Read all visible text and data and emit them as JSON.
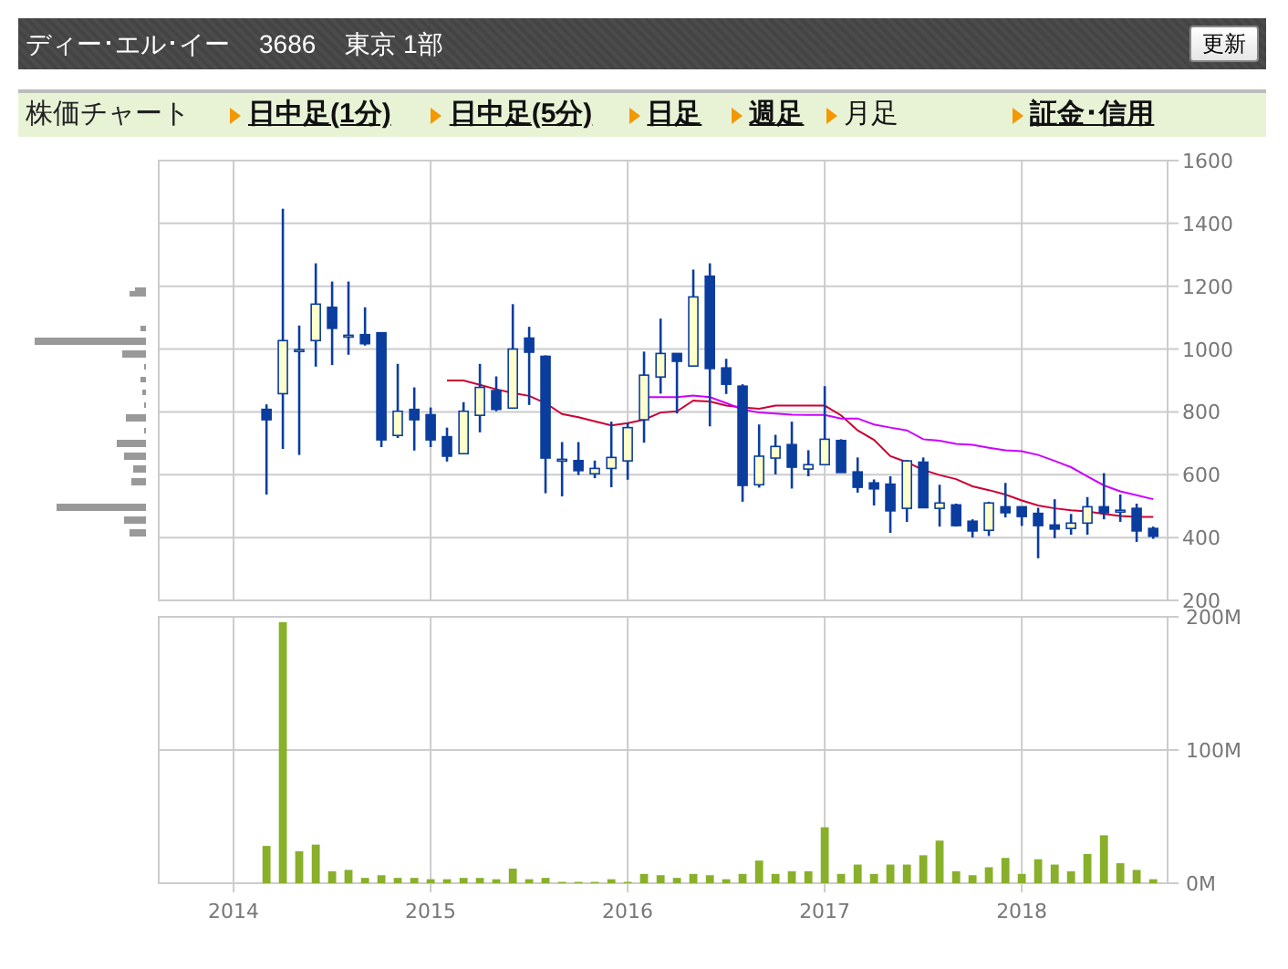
{
  "header": {
    "company": "ディー･エル･イー",
    "code": "3686",
    "market": "東京 1部",
    "refresh_button": "更新"
  },
  "chart_nav": {
    "label": "株価チャート",
    "tabs": [
      {
        "label": "日中足(1分)",
        "selected": false
      },
      {
        "label": "日中足(5分)",
        "selected": false
      },
      {
        "label": "日足",
        "selected": false
      },
      {
        "label": "週足",
        "selected": false
      },
      {
        "label": "月足",
        "selected": true
      },
      {
        "label": "証金･信用",
        "selected": false
      }
    ]
  },
  "price_chart": {
    "moving_averages": {
      "chart_data": {
        "type": "line",
        "grid": true,
        "xlim": [
          2013.62,
          2018.74
        ],
        "ylim": [
          200,
          1600
        ],
        "yticks": [
          200,
          400,
          600,
          800,
          1000,
          1200,
          1400,
          1600
        ],
        "x": [
          2015.083,
          2015.167,
          2015.25,
          2015.333,
          2015.417,
          2015.5,
          2015.583,
          2015.667,
          2015.75,
          2015.833,
          2015.917,
          2016,
          2016.083,
          2016.167,
          2016.25,
          2016.333,
          2016.417,
          2016.5,
          2016.583,
          2016.667,
          2016.75,
          2016.833,
          2016.917,
          2017,
          2017.083,
          2017.167,
          2017.25,
          2017.333,
          2017.417,
          2017.5,
          2017.583,
          2017.667,
          2017.75,
          2017.833,
          2017.917,
          2018,
          2018.083,
          2018.167,
          2018.25,
          2018.333,
          2018.417,
          2018.5,
          2018.583,
          2018.667
        ],
        "series": [
          {
            "color": "#cc0033",
            "values": [
              900,
              900,
              886,
              872,
              860,
              851,
              828,
              793,
              783,
              770,
              757,
              764,
              775,
              798,
              802,
              836,
              833,
              820,
              814,
              810,
              820,
              820,
              820,
              820,
              789,
              741,
              711,
              659,
              640,
              615,
              599,
              586,
              563,
              551,
              537,
              518,
              502,
              493,
              487,
              483,
              475,
              469,
              466,
              466
            ]
          },
          {
            "color": "#cc00ff",
            "values": [
              null,
              null,
              null,
              null,
              null,
              null,
              null,
              null,
              null,
              null,
              null,
              null,
              847,
              847,
              847,
              852,
              847,
              828,
              808,
              798,
              795,
              791,
              790,
              790,
              779,
              779,
              760,
              750,
              741,
              713,
              708,
              698,
              695,
              686,
              678,
              675,
              663,
              644,
              624,
              595,
              566,
              547,
              535,
              522
            ]
          }
        ]
      }
    },
    "candles": {
      "chart_data": {
        "type": "candlestick",
        "xlim": [
          2013.62,
          2018.74
        ],
        "ylim": [
          200,
          1600
        ],
        "x": [
          2014.167,
          2014.25,
          2014.333,
          2014.417,
          2014.5,
          2014.583,
          2014.667,
          2014.75,
          2014.833,
          2014.917,
          2015,
          2015.083,
          2015.167,
          2015.25,
          2015.333,
          2015.417,
          2015.5,
          2015.583,
          2015.667,
          2015.75,
          2015.833,
          2015.917,
          2016,
          2016.083,
          2016.167,
          2016.25,
          2016.333,
          2016.417,
          2016.5,
          2016.583,
          2016.667,
          2016.75,
          2016.833,
          2016.917,
          2017,
          2017.083,
          2017.167,
          2017.25,
          2017.333,
          2017.417,
          2017.5,
          2017.583,
          2017.667,
          2017.75,
          2017.833,
          2017.917,
          2018,
          2018.083,
          2018.167,
          2018.25,
          2018.333,
          2018.417,
          2018.5,
          2018.583,
          2018.667
        ],
        "ohlc": [
          [
            808,
            824,
            537,
            775
          ],
          [
            858,
            1447,
            682,
            1027
          ],
          [
            998,
            1075,
            663,
            998
          ],
          [
            1027,
            1273,
            944,
            1143
          ],
          [
            1133,
            1215,
            949,
            1066
          ],
          [
            1044,
            1215,
            982,
            1044
          ],
          [
            1046,
            1133,
            1011,
            1017
          ],
          [
            1052,
            1052,
            688,
            711
          ],
          [
            725,
            953,
            717,
            802
          ],
          [
            808,
            878,
            677,
            775
          ],
          [
            791,
            814,
            688,
            711
          ],
          [
            721,
            750,
            642,
            659
          ],
          [
            667,
            831,
            667,
            802
          ],
          [
            789,
            953,
            735,
            878
          ],
          [
            868,
            913,
            802,
            808
          ],
          [
            812,
            1143,
            812,
            1000
          ],
          [
            1035,
            1071,
            822,
            990
          ],
          [
            977,
            980,
            541,
            653
          ],
          [
            649,
            704,
            531,
            649
          ],
          [
            645,
            704,
            599,
            613
          ],
          [
            603,
            645,
            589,
            620
          ],
          [
            620,
            769,
            560,
            655
          ],
          [
            644,
            766,
            584,
            750
          ],
          [
            775,
            992,
            702,
            917
          ],
          [
            911,
            1097,
            858,
            986
          ],
          [
            986,
            986,
            795,
            961
          ],
          [
            946,
            1253,
            946,
            1166
          ],
          [
            1232,
            1273,
            754,
            938
          ],
          [
            940,
            969,
            857,
            888
          ],
          [
            882,
            888,
            514,
            566
          ],
          [
            568,
            760,
            559,
            659
          ],
          [
            653,
            727,
            601,
            690
          ],
          [
            696,
            769,
            556,
            624
          ],
          [
            618,
            678,
            595,
            632
          ],
          [
            632,
            882,
            632,
            713
          ],
          [
            709,
            713,
            607,
            607
          ],
          [
            609,
            655,
            543,
            560
          ],
          [
            574,
            585,
            502,
            555
          ],
          [
            570,
            595,
            415,
            485
          ],
          [
            493,
            647,
            450,
            644
          ],
          [
            640,
            655,
            495,
            495
          ],
          [
            493,
            568,
            435,
            510
          ],
          [
            504,
            508,
            435,
            438
          ],
          [
            452,
            458,
            400,
            421
          ],
          [
            423,
            514,
            405,
            510
          ],
          [
            498,
            574,
            464,
            479
          ],
          [
            498,
            498,
            437,
            467
          ],
          [
            477,
            495,
            334,
            438
          ],
          [
            440,
            522,
            398,
            427
          ],
          [
            429,
            475,
            409,
            446
          ],
          [
            446,
            529,
            409,
            498
          ],
          [
            498,
            605,
            458,
            479
          ],
          [
            487,
            537,
            450,
            487
          ],
          [
            493,
            508,
            386,
            421
          ],
          [
            429,
            435,
            396,
            404
          ]
        ]
      }
    }
  },
  "volume_chart": {
    "chart_data": {
      "type": "bar",
      "grid": true,
      "xlim": [
        2013.62,
        2018.74
      ],
      "ylim": [
        0,
        200
      ],
      "yticks": [
        {
          "value": 0,
          "label": "0M"
        },
        {
          "value": 100,
          "label": "100M"
        },
        {
          "value": 200,
          "label": "200M"
        }
      ],
      "xticks": [
        2014,
        2015,
        2016,
        2017,
        2018
      ],
      "x": [
        2014.167,
        2014.25,
        2014.333,
        2014.417,
        2014.5,
        2014.583,
        2014.667,
        2014.75,
        2014.833,
        2014.917,
        2015,
        2015.083,
        2015.167,
        2015.25,
        2015.333,
        2015.417,
        2015.5,
        2015.583,
        2015.667,
        2015.75,
        2015.833,
        2015.917,
        2016,
        2016.083,
        2016.167,
        2016.25,
        2016.333,
        2016.417,
        2016.5,
        2016.583,
        2016.667,
        2016.75,
        2016.833,
        2016.917,
        2017,
        2017.083,
        2017.167,
        2017.25,
        2017.333,
        2017.417,
        2017.5,
        2017.583,
        2017.667,
        2017.75,
        2017.833,
        2017.917,
        2018,
        2018.083,
        2018.167,
        2018.25,
        2018.333,
        2018.417,
        2018.5,
        2018.583,
        2018.667
      ],
      "series": [
        {
          "color": "#88b02a",
          "values": [
            28,
            196,
            24,
            29,
            9,
            10,
            4,
            6,
            4,
            4,
            3,
            3,
            4,
            4,
            3,
            11,
            3,
            4,
            1,
            1,
            1,
            3,
            1,
            7,
            6,
            4,
            7,
            6,
            3,
            7,
            17,
            7,
            9,
            9,
            42,
            7,
            14,
            7,
            14,
            14,
            21,
            32,
            9,
            6,
            12,
            19,
            7,
            18,
            14,
            9,
            22,
            36,
            15,
            10,
            3
          ]
        }
      ]
    }
  }
}
